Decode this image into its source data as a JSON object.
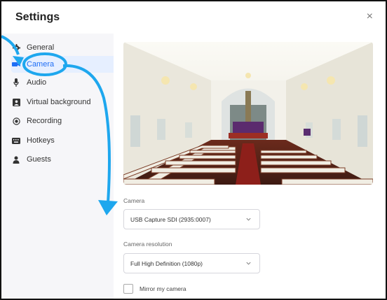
{
  "dialog": {
    "title": "Settings",
    "close_glyph": "×"
  },
  "sidebar": {
    "items": [
      {
        "label": "General",
        "icon": "gear-icon"
      },
      {
        "label": "Camera",
        "icon": "camera-icon",
        "active": true
      },
      {
        "label": "Audio",
        "icon": "microphone-icon"
      },
      {
        "label": "Virtual background",
        "icon": "image-icon"
      },
      {
        "label": "Recording",
        "icon": "record-icon"
      },
      {
        "label": "Hotkeys",
        "icon": "keyboard-icon"
      },
      {
        "label": "Guests",
        "icon": "person-icon"
      }
    ]
  },
  "camera": {
    "label": "Camera",
    "value": "USB Capture SDI (2935:0007)",
    "resolution_label": "Camera resolution",
    "resolution_value": "Full High Definition (1080p)",
    "mirror_label": "Mirror my camera",
    "mirror_checked": false
  },
  "colors": {
    "accent": "#1e6ef5",
    "annotation": "#1ea7ee"
  }
}
